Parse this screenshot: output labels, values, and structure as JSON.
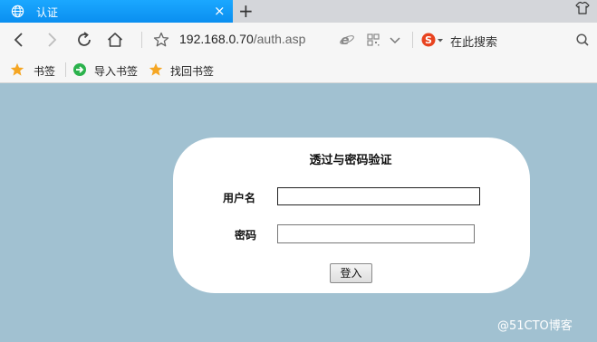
{
  "tab": {
    "title": "认证",
    "close_glyph": "×",
    "icon": "globe-icon"
  },
  "new_tab_glyph": "+",
  "toolbar": {
    "url_host": "192.168.0.70",
    "url_path": "/auth.asp",
    "search_placeholder": "在此搜索"
  },
  "bookmarks": [
    {
      "label": "书签",
      "icon": "star-icon"
    },
    {
      "label": "导入书签",
      "icon": "import-icon"
    },
    {
      "label": "找回书签",
      "icon": "star-icon"
    }
  ],
  "login": {
    "title": "透过与密码验证",
    "username_label": "用户名",
    "password_label": "密码",
    "username_value": "",
    "password_value": "",
    "submit_label": "登入"
  },
  "watermark": "@51CTO博客",
  "colors": {
    "tab_active": "#0a8ff0",
    "page_background": "#a1c1d1",
    "bookmark_star": "#f5a623",
    "import_green": "#2bb24c"
  }
}
